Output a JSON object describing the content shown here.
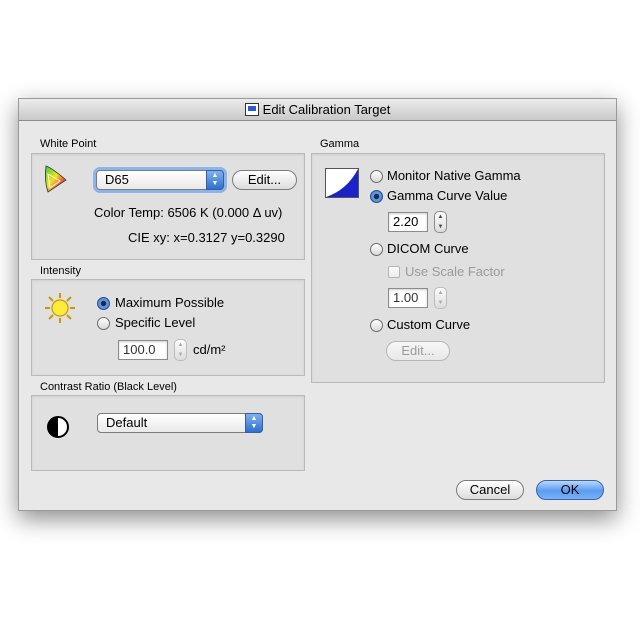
{
  "window": {
    "title": "Edit Calibration Target",
    "title_icon": "monitor-icon"
  },
  "white_point": {
    "label": "White Point",
    "preset": "D65",
    "edit_label": "Edit...",
    "color_temp": "Color Temp:  6506 K (0.000 Δ uv)",
    "cie_xy": "CIE xy:  x=0.3127 y=0.3290",
    "icon": "chromaticity-diagram-icon"
  },
  "intensity": {
    "label": "Intensity",
    "options": [
      "Maximum Possible",
      "Specific Level"
    ],
    "selected": "Maximum Possible",
    "level_value": "100.0",
    "unit": "cd/m²",
    "icon": "sun-icon"
  },
  "contrast": {
    "label": "Contrast Ratio (Black Level)",
    "value": "Default",
    "icon": "contrast-icon"
  },
  "gamma": {
    "label": "Gamma",
    "options": [
      "Monitor Native Gamma",
      "Gamma Curve Value",
      "DICOM Curve",
      "Custom Curve"
    ],
    "selected": "Gamma Curve Value",
    "curve_value": "2.20",
    "use_scale_factor": "Use Scale Factor",
    "scale_value": "1.00",
    "edit_label": "Edit...",
    "icon": "gamma-curve-icon"
  },
  "buttons": {
    "cancel": "Cancel",
    "ok": "OK"
  },
  "colors": {
    "accent": "#3a7ee0",
    "gamma_fill": "#1a22c8"
  }
}
